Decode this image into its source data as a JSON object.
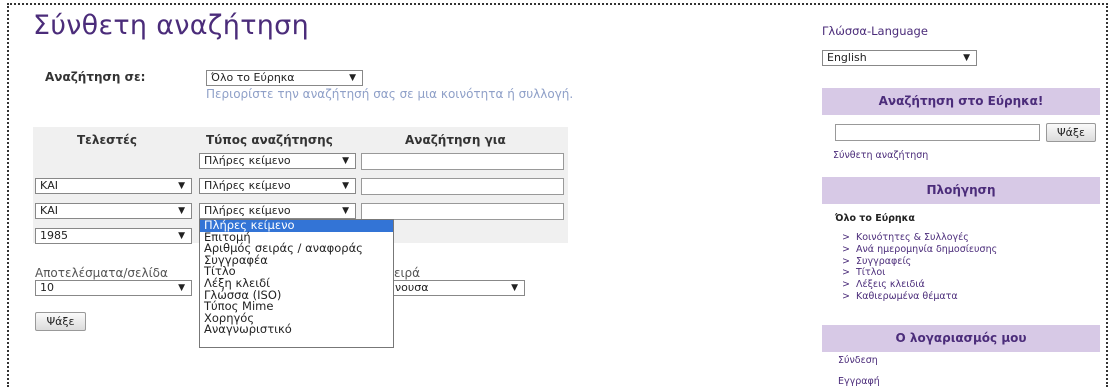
{
  "page_title": "Σύνθετη αναζήτηση",
  "search_in": {
    "label": "Αναζήτηση σε:",
    "value": "Όλο το Εύρηκα",
    "hint": "Περιορίστε την αναζήτησή σας σε μια κοινότητα ή συλλογή."
  },
  "table": {
    "headers": [
      "Τελεστές",
      "Τύπος αναζήτησης",
      "Αναζήτηση για"
    ],
    "rows": [
      {
        "operator": "",
        "type": "Πλήρες κείμενο"
      },
      {
        "operator": "ΚΑΙ",
        "type": "Πλήρες κείμενο"
      },
      {
        "operator": "ΚΑΙ",
        "type": "Πλήρες κείμενο"
      },
      {
        "operator": "1985"
      }
    ]
  },
  "dropdown_options": [
    "Πλήρες κείμενο",
    "Επιτομή",
    "Αριθμός σειράς / αναφοράς",
    "Συγγραφέα",
    "Τίτλο",
    "Λέξη κλειδί",
    "Γλώσσα (ISO)",
    "Τύπος Mime",
    "Χορηγός",
    "Αναγνωριστικό"
  ],
  "results_per_page": {
    "label": "Αποτελέσματα/σελίδα",
    "value": "10"
  },
  "order": {
    "label_fragment": "ειρά",
    "value_fragment": "νουσα"
  },
  "search_button": "Ψάξε",
  "sidebar": {
    "language_label": "Γλώσσα-Language",
    "language_value": "English",
    "search_header": "Αναζήτηση στο Εύρηκα!",
    "search_button": "Ψάξε",
    "advanced_link": "Σύνθετη αναζήτηση",
    "nav_header": "Πλοήγηση",
    "nav_scope": "Όλο το Εύρηκα",
    "nav_items": [
      "Κοινότητες & Συλλογές",
      "Ανά ημερομηνία δημοσίευσης",
      "Συγγραφείς",
      "Τίτλοι",
      "Λέξεις κλειδιά",
      "Καθιερωμένα θέματα"
    ],
    "account_header": "Ο λογαριασμός μου",
    "account_links": [
      "Σύνδεση",
      "Εγγραφή"
    ]
  },
  "icons": {
    "select_arrow": "▼",
    "nav_bullet": ">"
  }
}
